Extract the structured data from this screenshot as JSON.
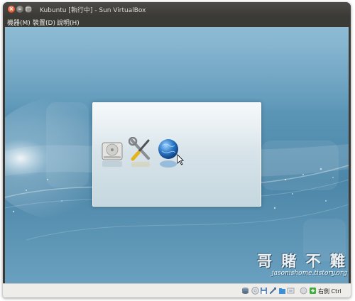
{
  "window": {
    "title": "Kubuntu [執行中] - Sun VirtualBox",
    "controls": [
      "close-icon",
      "minimize-icon",
      "maximize-icon"
    ]
  },
  "menubar": {
    "items": [
      {
        "label": "機器(M)"
      },
      {
        "label": "裝置(D)"
      },
      {
        "label": "說明(H)"
      }
    ]
  },
  "guest": {
    "splash_icons": [
      "hard-disk-icon",
      "tools-icon",
      "globe-icon"
    ],
    "pointer": "mouse-cursor-icon"
  },
  "watermark": {
    "text": "哥 賭 不 難",
    "url": "jasonishome.tistory.org"
  },
  "statusbar": {
    "icons": [
      "hard-disk-status-icon",
      "cd-status-icon",
      "floppy-status-icon",
      "usb-status-icon",
      "shared-folders-icon",
      "network-status-icon",
      "seamless-icon",
      "mouse-integration-icon",
      "green-arrow-icon"
    ],
    "host_key": "右側 Ctrl"
  },
  "colors": {
    "titlebar": "#3b3a37",
    "close_button": "#e0522a",
    "desktop": "#5d97b8",
    "statusbar": "#efedea"
  }
}
